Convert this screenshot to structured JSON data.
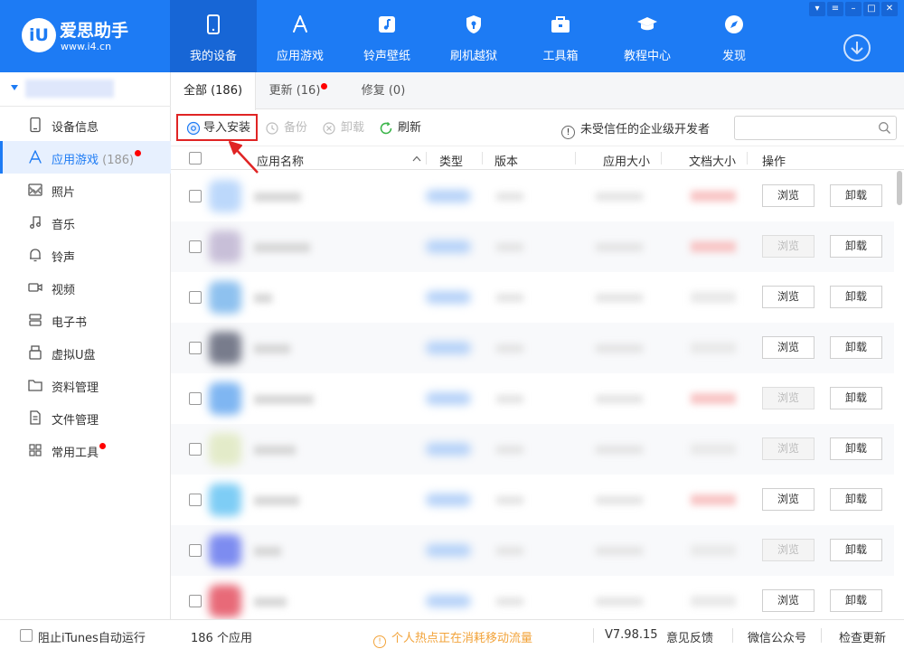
{
  "app": {
    "brand_name": "爱思助手",
    "brand_url": "www.i4.cn",
    "logo_mark": "iU"
  },
  "nav": [
    {
      "label": "我的设备",
      "icon": "phone-icon"
    },
    {
      "label": "应用游戏",
      "icon": "app-store-icon"
    },
    {
      "label": "铃声壁纸",
      "icon": "music-note-icon"
    },
    {
      "label": "刷机越狱",
      "icon": "jailbreak-icon"
    },
    {
      "label": "工具箱",
      "icon": "toolbox-icon"
    },
    {
      "label": "教程中心",
      "icon": "graduation-cap-icon"
    },
    {
      "label": "发现",
      "icon": "compass-icon"
    }
  ],
  "sidebar": {
    "items": [
      {
        "label": "设备信息",
        "icon": "device-info-icon"
      },
      {
        "label": "应用游戏",
        "count": "(186)",
        "icon": "app-icon"
      },
      {
        "label": "照片",
        "icon": "photo-icon"
      },
      {
        "label": "音乐",
        "icon": "music-icon"
      },
      {
        "label": "铃声",
        "icon": "bell-icon"
      },
      {
        "label": "视频",
        "icon": "video-icon"
      },
      {
        "label": "电子书",
        "icon": "ebook-icon"
      },
      {
        "label": "虚拟U盘",
        "icon": "usb-drive-icon"
      },
      {
        "label": "资料管理",
        "icon": "folder-icon"
      },
      {
        "label": "文件管理",
        "icon": "file-icon"
      },
      {
        "label": "常用工具",
        "icon": "grid-icon"
      }
    ]
  },
  "tabs": [
    {
      "label": "全部 (186)"
    },
    {
      "label": "更新 (16)"
    },
    {
      "label": "修复 (0)"
    }
  ],
  "toolbar": {
    "import": "导入安装",
    "backup": "备份",
    "uninstall": "卸载",
    "refresh": "刷新",
    "warning": "未受信任的企业级开发者",
    "search_placeholder": ""
  },
  "columns": {
    "name": "应用名称",
    "type": "类型",
    "version": "版本",
    "app_size": "应用大小",
    "doc_size": "文档大小",
    "action": "操作"
  },
  "row_actions": {
    "browse": "浏览",
    "uninstall": "卸载"
  },
  "rows": [
    {
      "browse_enabled": true,
      "icon_color": "#bcd8fb"
    },
    {
      "browse_enabled": false,
      "icon_color": "#c8bfd8"
    },
    {
      "browse_enabled": true,
      "icon_color": "#8ec1ef"
    },
    {
      "browse_enabled": true,
      "icon_color": "#787c8c"
    },
    {
      "browse_enabled": false,
      "icon_color": "#7fb6f2"
    },
    {
      "browse_enabled": false,
      "icon_color": "#e3ebc9"
    },
    {
      "browse_enabled": true,
      "icon_color": "#7ecdf5"
    },
    {
      "browse_enabled": false,
      "icon_color": "#7d8cf0"
    },
    {
      "browse_enabled": true,
      "icon_color": "#e86a78"
    }
  ],
  "status": {
    "block_itunes": "阻止iTunes自动运行",
    "app_count": "186 个应用",
    "traffic_notice": "个人热点正在消耗移动流量",
    "version": "V7.98.15",
    "feedback": "意见反馈",
    "wechat": "微信公众号",
    "update": "检查更新"
  },
  "colors": {
    "brand_blue": "#1d7bf4",
    "highlight_red": "#e02424",
    "badge_red": "#ff0000",
    "warning_orange": "#f2a33a"
  }
}
